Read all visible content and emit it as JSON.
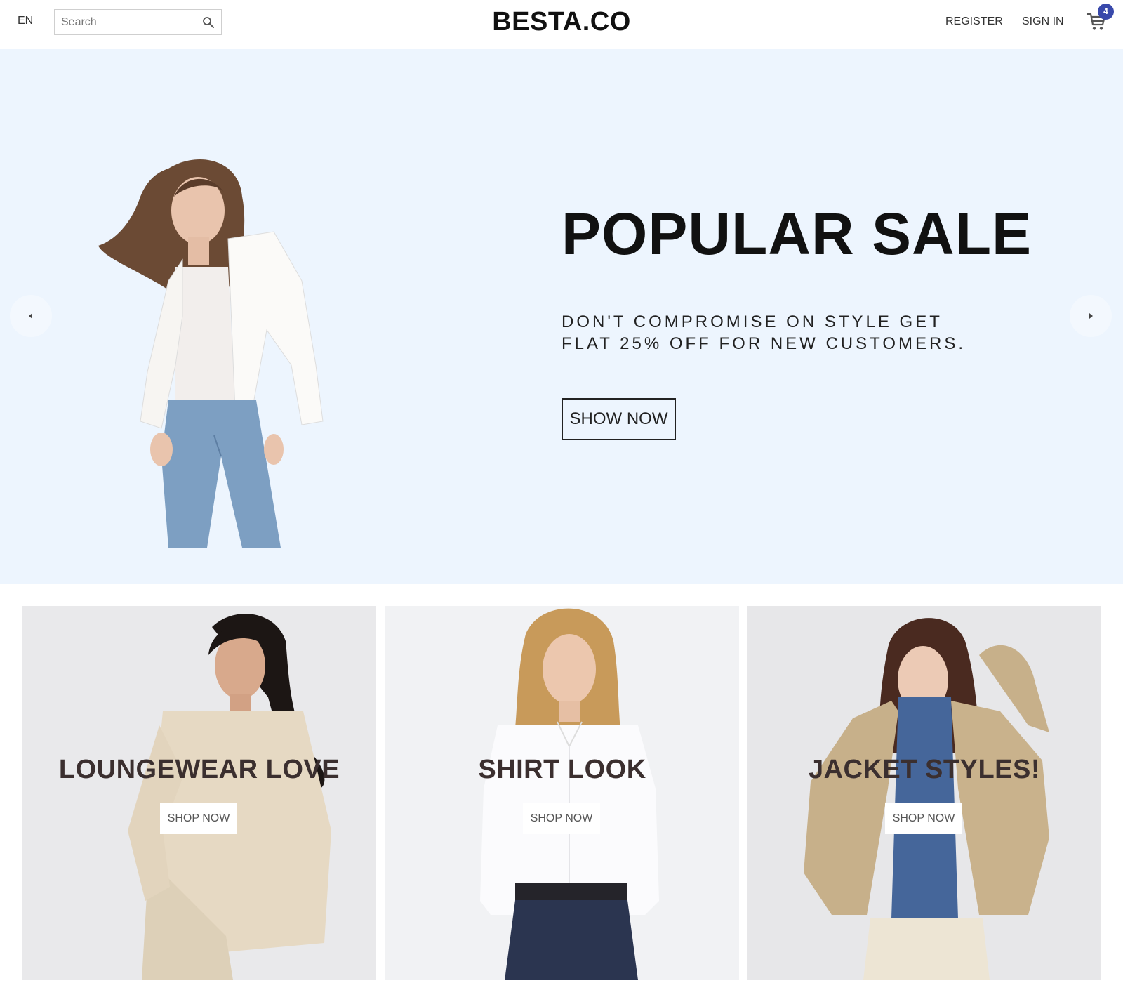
{
  "header": {
    "language": "EN",
    "search": {
      "placeholder": "Search",
      "value": ""
    },
    "logo": "BESTA.CO",
    "register_label": "REGISTER",
    "signin_label": "SIGN IN",
    "cart_count": "4"
  },
  "hero": {
    "title": "POPULAR SALE",
    "subtitle": "DON'T COMPROMISE ON STYLE GET FLAT 25% OFF FOR NEW CUSTOMERS.",
    "button_label": "SHOW NOW",
    "background_color": "#edf5fe"
  },
  "categories": [
    {
      "title": "LOUNGEWEAR LOVE",
      "button_label": "SHOP NOW"
    },
    {
      "title": "SHIRT LOOK",
      "button_label": "SHOP NOW"
    },
    {
      "title": "JACKET STYLES!",
      "button_label": "SHOP NOW"
    }
  ],
  "colors": {
    "badge": "#3949ab",
    "card_title": "#3b2f2f"
  }
}
